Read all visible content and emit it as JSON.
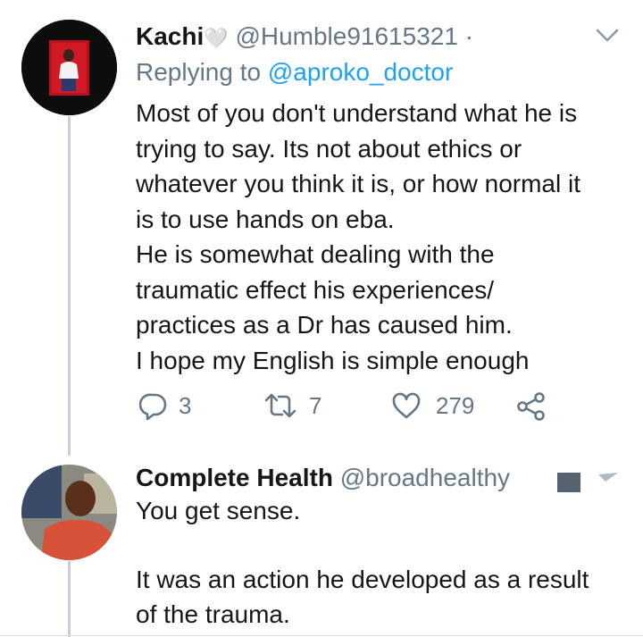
{
  "tweet1": {
    "name": "Kachi",
    "heart_emoji": "🤍",
    "handle": "@Humble91615321",
    "separator": "·",
    "replying_prefix": "Replying to",
    "replying_handle": "@aproko_doctor",
    "lines": [
      "Most of you don't understand what he is",
      "trying to say. Its not about ethics or",
      "whatever you think it is, or how normal it",
      "is to use hands on eba.",
      "He is somewhat dealing with the",
      "traumatic effect his experiences/",
      "practices as a Dr has caused him.",
      "I hope my English is simple enough"
    ],
    "replies": "3",
    "retweets": "7",
    "likes": "279",
    "icons": [
      "reply-icon",
      "retweet-icon",
      "like-icon",
      "share-icon",
      "chevron-down-icon"
    ]
  },
  "tweet2": {
    "name": "Complete Health",
    "handle": "@broadhealthy",
    "lines": [
      "You get sense.",
      "",
      "It was an action he developed as a result",
      "of the trauma."
    ]
  },
  "colors": {
    "accent": "#1da1f2",
    "secondary_text": "#657786",
    "thread_line": "#c4cfd6"
  }
}
